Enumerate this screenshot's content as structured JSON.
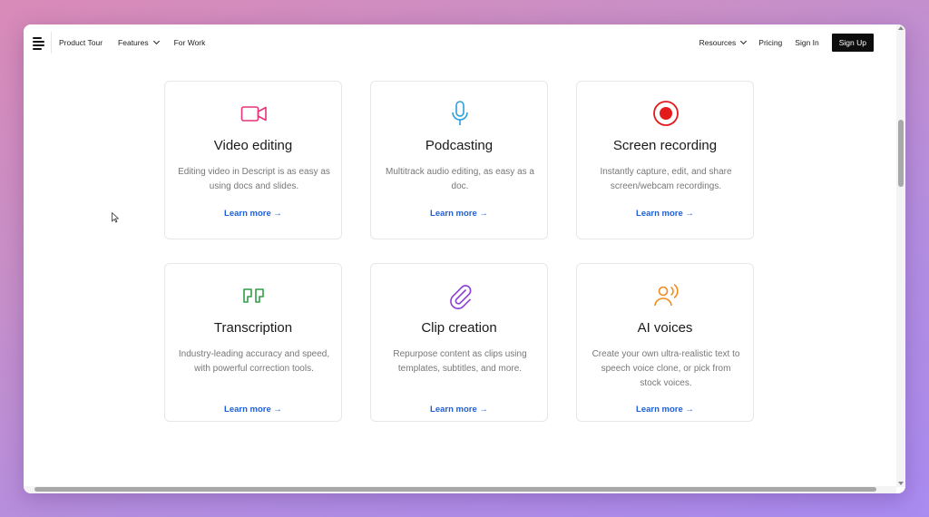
{
  "nav": {
    "left": [
      {
        "label": "Product Tour",
        "dropdown": false
      },
      {
        "label": "Features",
        "dropdown": true
      },
      {
        "label": "For Work",
        "dropdown": false
      }
    ],
    "right": [
      {
        "label": "Resources",
        "dropdown": true
      },
      {
        "label": "Pricing",
        "dropdown": false
      },
      {
        "label": "Sign In",
        "dropdown": false
      }
    ],
    "signup_label": "Sign Up"
  },
  "cards": [
    {
      "title": "Video editing",
      "desc": "Editing video in Descript is as easy as using docs and slides.",
      "link": "Learn more →",
      "icon": "video-camera-icon",
      "color": "#e6347a"
    },
    {
      "title": "Podcasting",
      "desc": "Multitrack audio editing, as easy as a doc.",
      "link": "Learn more →",
      "icon": "microphone-icon",
      "color": "#2b9fd9"
    },
    {
      "title": "Screen recording",
      "desc": "Instantly capture, edit, and share screen/webcam recordings.",
      "link": "Learn more →",
      "icon": "record-icon",
      "color": "#e31b1b"
    },
    {
      "title": "Transcription",
      "desc": "Industry-leading accuracy and speed, with powerful correction tools.",
      "link": "Learn more →",
      "icon": "quote-icon",
      "color": "#2f9e44"
    },
    {
      "title": "Clip creation",
      "desc": "Repurpose content as clips using templates, subtitles, and more.",
      "link": "Learn more →",
      "icon": "paperclip-icon",
      "color": "#8a3fd6"
    },
    {
      "title": "AI voices",
      "desc": "Create your own ultra-realistic text to speech voice clone, or pick from stock voices.",
      "link": "Learn more →",
      "icon": "voice-person-icon",
      "color": "#f08c1a"
    }
  ]
}
